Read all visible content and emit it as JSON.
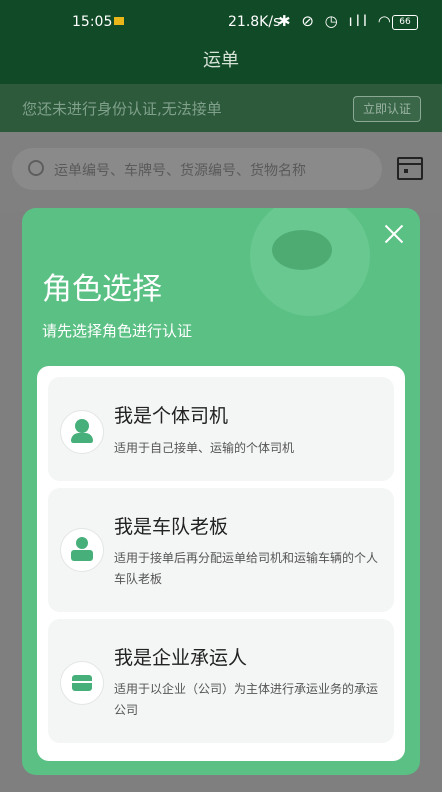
{
  "status_bar": {
    "time": "15:05",
    "network_speed": "21.8K/s",
    "icons": "✱ ⊘ ◷ ıll ◠",
    "battery": "66"
  },
  "header": {
    "title": "运单"
  },
  "verify_banner": {
    "message": "您还未进行身份认证,无法接单",
    "button_label": "立即认证"
  },
  "search": {
    "placeholder": "运单编号、车牌号、货源编号、货物名称"
  },
  "modal": {
    "title": "角色选择",
    "subtitle": "请先选择角色进行认证",
    "roles": [
      {
        "title": "我是个体司机",
        "description": "适用于自己接单、运输的个体司机",
        "icon": "driver-icon"
      },
      {
        "title": "我是车队老板",
        "description": "适用于接单后再分配运单给司机和运输车辆的个人车队老板",
        "icon": "fleet-owner-icon"
      },
      {
        "title": "我是企业承运人",
        "description": "适用于以企业（公司）为主体进行承运业务的承运公司",
        "icon": "briefcase-icon"
      }
    ]
  },
  "colors": {
    "primary_green": "#5bc084",
    "header_green": "#1a6b37",
    "icon_green": "#47b07a"
  }
}
